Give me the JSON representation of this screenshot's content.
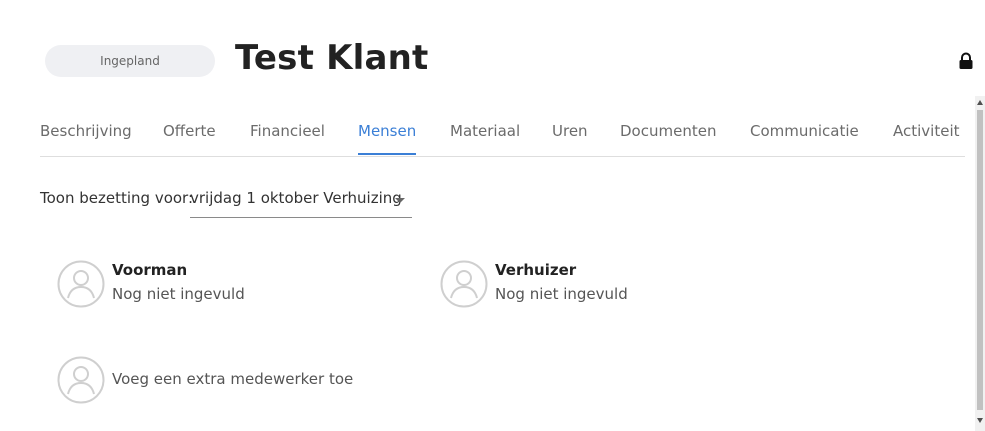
{
  "header": {
    "status": "Ingepland",
    "title": "Test Klant"
  },
  "tabs": [
    {
      "label": "Beschrijving",
      "active": false
    },
    {
      "label": "Offerte",
      "active": false
    },
    {
      "label": "Financieel",
      "active": false
    },
    {
      "label": "Mensen",
      "active": true
    },
    {
      "label": "Materiaal",
      "active": false
    },
    {
      "label": "Uren",
      "active": false
    },
    {
      "label": "Documenten",
      "active": false
    },
    {
      "label": "Communicatie",
      "active": false
    },
    {
      "label": "Activiteit",
      "active": false
    }
  ],
  "filter": {
    "label": "Toon bezetting voor:",
    "selected": "vrijdag 1 oktober Verhuizing"
  },
  "people": [
    {
      "role": "Voorman",
      "status": "Nog niet ingevuld"
    },
    {
      "role": "Verhuizer",
      "status": "Nog niet ingevuld"
    }
  ],
  "add_employee": {
    "label": "Voeg een extra medewerker toe"
  },
  "colors": {
    "accent": "#3b7fd6",
    "status_pill_bg": "#eff0f3",
    "avatar_stroke": "#cfcfcf"
  }
}
